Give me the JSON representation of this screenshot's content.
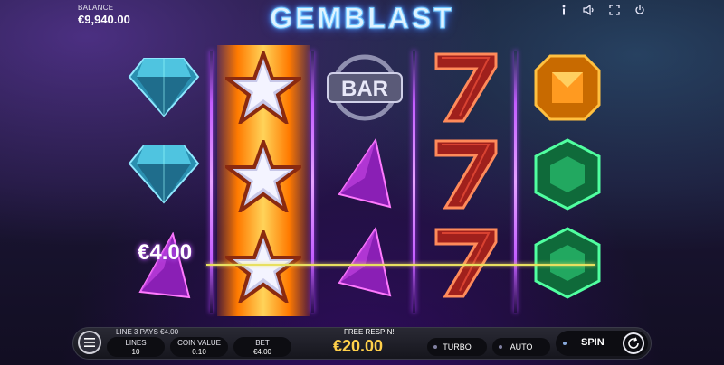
{
  "header": {
    "balance_label": "BALANCE",
    "balance_value": "€9,940.00",
    "logo_text": "GEMBLAST",
    "icons": [
      "info-icon",
      "sound-icon",
      "fullscreen-icon",
      "power-icon"
    ]
  },
  "reels": {
    "columns": [
      [
        "blue-diamond",
        "blue-diamond",
        "purple-shard"
      ],
      [
        "silver-star",
        "silver-star",
        "silver-star"
      ],
      [
        "bar",
        "purple-shard",
        "purple-shard"
      ],
      [
        "red-seven",
        "red-seven",
        "red-seven"
      ],
      [
        "orange-gem",
        "green-gem",
        "green-gem"
      ]
    ],
    "win_amount": "€4.00",
    "colors": {
      "reel_highlight": "#ff8a00",
      "separator": "#c25cff",
      "payline": "#e8e060"
    }
  },
  "controls": {
    "line_pays": "LINE 3 PAYS €4.00",
    "lines_label": "LINES",
    "lines_value": "10",
    "coin_label": "COIN VALUE",
    "coin_value": "0.10",
    "bet_label": "BET",
    "bet_value": "€4.00",
    "free_respin": "FREE RESPIN!",
    "win_total": "€20.00",
    "turbo_label": "TURBO",
    "auto_label": "AUTO",
    "spin_label": "SPIN"
  }
}
